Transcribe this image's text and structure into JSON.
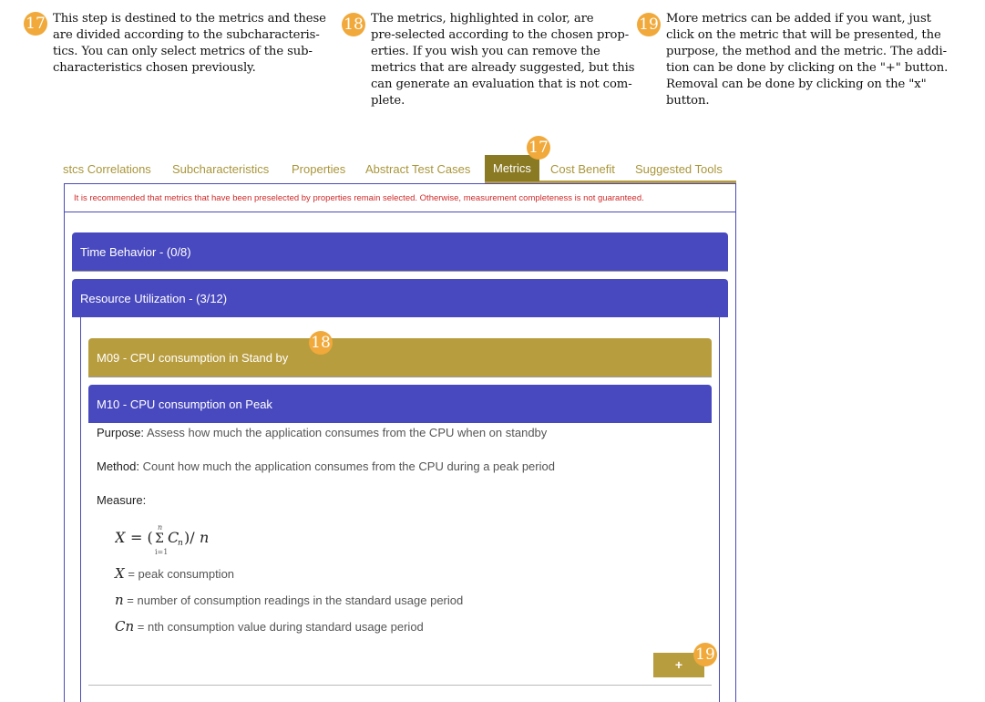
{
  "annotations": [
    {
      "badge": "17",
      "lines": [
        "This step is destined to the metrics and these",
        "are divided according to the subcharacteris-",
        "tics. You can only select metrics of the sub-",
        "characteristics chosen previously."
      ]
    },
    {
      "badge": "18",
      "lines": [
        "The metrics, highlighted in color, are",
        "pre-selected according to the chosen prop-",
        "erties. If you wish you can remove the",
        "metrics that are already suggested, but this",
        "can generate an evaluation that is not com-",
        "plete."
      ]
    },
    {
      "badge": "19",
      "lines": [
        "More metrics can be added if you want, just",
        "click on the metric that will be presented, the",
        "purpose, the method and the metric. The addi-",
        "tion can be done by clicking on the \"+\" button.",
        "Removal can be done by clicking on the \"x\"",
        "button."
      ]
    }
  ],
  "markers": {
    "tab": "17",
    "metric": "18",
    "add": "19"
  },
  "tabs": [
    {
      "label": "stcs Correlations"
    },
    {
      "label": "Subcharacteristics"
    },
    {
      "label": "Properties"
    },
    {
      "label": "Abstract Test Cases"
    },
    {
      "label": "Metrics",
      "active": true
    },
    {
      "label": "Cost Benefit"
    },
    {
      "label": "Suggested Tools"
    }
  ],
  "alert": "It is recommended that metrics that have been preselected by properties remain selected. Otherwise, measurement completeness is not guaranteed.",
  "groups": [
    {
      "label": "Time Behavior - (0/8)"
    },
    {
      "label": "Resource Utilization - (3/12)"
    }
  ],
  "metrics": [
    {
      "label": "M09 - CPU consumption in Stand by",
      "color": "#b89d3e"
    },
    {
      "label": "M10 - CPU consumption on Peak",
      "color": "#4949bf"
    }
  ],
  "detail": {
    "purpose_label": "Purpose:",
    "purpose": "Assess how much the application consumes from the CPU when on standby",
    "method_label": "Method:",
    "method": "Count how much the application consumes from the CPU during a peak period",
    "measure_label": "Measure:",
    "formula": "X = (Σ Cn)/n, i=1..n",
    "variables": [
      {
        "symbol": "X",
        "desc": "= peak consumption"
      },
      {
        "symbol": "n",
        "desc": "= number of consumption readings in the standard usage period"
      },
      {
        "symbol": "Cn",
        "desc": "= nth consumption value during standard usage period"
      }
    ]
  },
  "add_label": "+"
}
